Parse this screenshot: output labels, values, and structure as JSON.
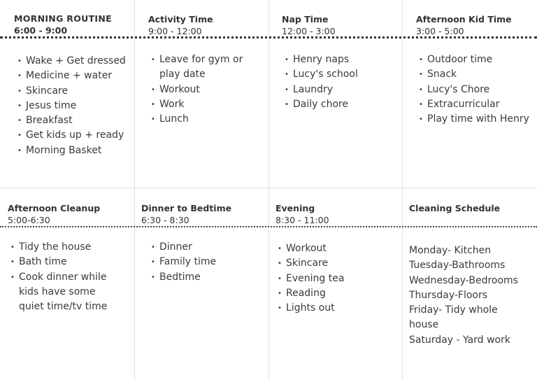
{
  "top_row": [
    {
      "title": "MORNING ROUTINE",
      "time": "6:00 - 9:00",
      "items": [
        "Wake + Get dressed",
        "Medicine + water",
        "Skincare",
        "Jesus time",
        "Breakfast",
        "Get kids up + ready",
        "Morning Basket"
      ]
    },
    {
      "title": "Activity Time",
      "time": "9:00 - 12:00",
      "items": [
        "Leave for gym or play date",
        "Workout",
        "Work",
        "Lunch"
      ]
    },
    {
      "title": "Nap Time",
      "time": "12:00 - 3:00",
      "items": [
        "Henry naps",
        "Lucy's school",
        "Laundry",
        "Daily chore"
      ]
    },
    {
      "title": "Afternoon Kid Time",
      "time": "3:00 - 5:00",
      "items": [
        "Outdoor time",
        "Snack",
        "Lucy's Chore",
        "Extracurricular",
        "Play time with Henry"
      ]
    }
  ],
  "bottom_row": [
    {
      "title": "Afternoon Cleanup",
      "time": "5:00-6:30",
      "items": [
        "Tidy the house",
        "Bath time",
        "Cook dinner while kids have some quiet time/tv time"
      ]
    },
    {
      "title": "Dinner to Bedtime",
      "time": "6:30 - 8:30",
      "items": [
        "Dinner",
        "Family time",
        "Bedtime"
      ]
    },
    {
      "title": "Evening",
      "time": "8:30 - 11:00",
      "items": [
        "Workout",
        "Skincare",
        "Evening tea",
        "Reading",
        "Lights out"
      ]
    },
    {
      "title": "Cleaning Schedule",
      "lines": [
        "Monday- Kitchen",
        "Tuesday-Bathrooms",
        "Wednesday-Bedrooms",
        "Thursday-Floors",
        "Friday- Tidy whole house",
        "Saturday - Yard work"
      ]
    }
  ]
}
